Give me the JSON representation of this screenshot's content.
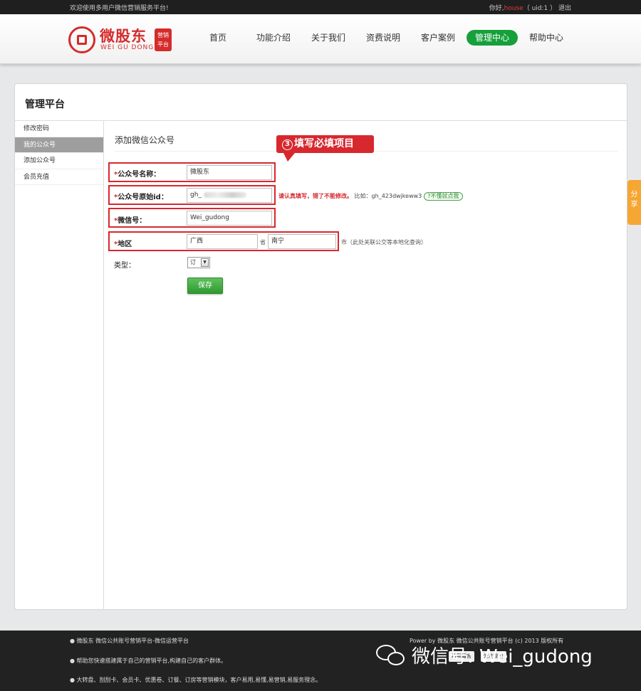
{
  "topbar": {
    "welcome": "欢迎使用多用户微信营销服务平台!",
    "greeting": "你好,",
    "username": "house",
    "uid": "（ uid:1 ）",
    "logout": "退出"
  },
  "brand": {
    "name": "微股东",
    "pinyin": "WEI GU DONG",
    "badge_line1": "营销",
    "badge_line2": "平台",
    "color": "#d52b2b"
  },
  "nav": {
    "items": [
      "首页",
      "功能介绍",
      "关于我们",
      "资费说明",
      "客户案例",
      "管理中心",
      "帮助中心"
    ],
    "active": "管理中心",
    "active_color": "#16a03b"
  },
  "panel": {
    "title": "管理平台"
  },
  "sidebar": {
    "items": [
      "修改密码",
      "我的公众号",
      "添加公众号",
      "会员充值"
    ],
    "active": "我的公众号"
  },
  "content": {
    "title": "添加微信公众号"
  },
  "callout": {
    "number": "3",
    "text": "填写必填项目",
    "color": "#d7282e"
  },
  "form": {
    "account_name": {
      "label": "公众号名称：",
      "value": "微股东"
    },
    "original_id": {
      "label": "公众号原始id：",
      "value": "gh_",
      "hint_warn": "请认真填写，错了不能修改。",
      "hint_example": "比如：gh_423dwjkeww3",
      "hint_link": "不懂就点我"
    },
    "wechat_id": {
      "label": "微信号：",
      "value": "Wei_gudong"
    },
    "region": {
      "label": "地区",
      "province": "广西",
      "province_suffix": "省",
      "city": "南宁",
      "city_suffix": "市",
      "note": "（此处关联公交等本地化查询）"
    },
    "type": {
      "label": "类型：",
      "value": "订"
    },
    "save_label": "保存"
  },
  "share_tab": {
    "line1": "分",
    "line2": "享",
    "color": "#f6a632"
  },
  "footer": {
    "line1": "● 微股东 微信公共账号营销平台-微信运营平台",
    "line2": "● 帮助您快速搭建属于自己的营销平台,构建自己的客户群体。",
    "line3": "● 大转盘、刮刮卡、会员卡、优惠卷、订餐、订房等营销模块，客户易用,易懂,易营销,易服务理念。",
    "power": "Power by 微股东 微信公共账号营销平台 (c) 2013 版权所有",
    "icon1": "给我留言",
    "icon2": "关注我们"
  },
  "watermark": {
    "text": "微信号: Wei_gudong"
  }
}
